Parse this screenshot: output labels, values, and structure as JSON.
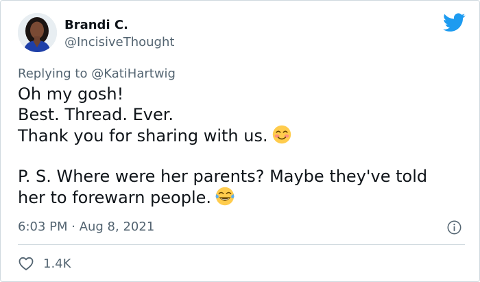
{
  "tweet": {
    "display_name": "Brandi C.",
    "handle": "@IncisiveThought",
    "reply_prefix": "Replying to",
    "reply_mention": "@KatiHartwig",
    "lines": [
      "Oh my gosh!",
      "Best. Thread. Ever.",
      "Thank you for sharing with us.",
      "P. S. Where were her parents? Maybe they've told",
      "her to forewarn people."
    ],
    "timestamp": "6:03 PM · Aug 8, 2021",
    "likes": "1.4K"
  },
  "icons": {
    "brand": "twitter-bird-icon",
    "info": "info-icon",
    "like": "heart-icon",
    "emoji_1": "smiling-face-icon",
    "emoji_2": "tears-of-joy-icon"
  },
  "colors": {
    "brand_blue": "#1d9bf0",
    "text_primary": "#0f1419",
    "text_secondary": "#536471",
    "divider": "#cfd9de"
  }
}
